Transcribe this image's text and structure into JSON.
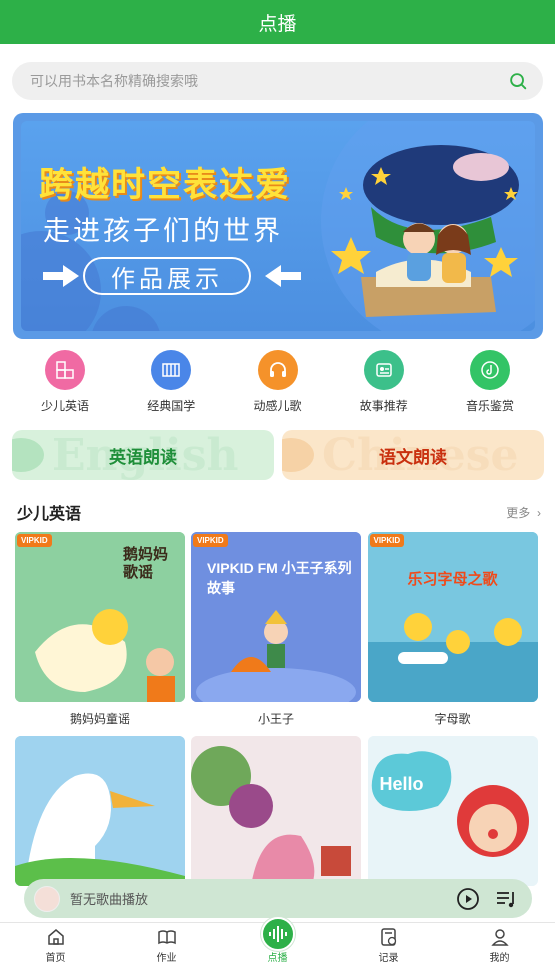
{
  "header": {
    "title": "点播"
  },
  "search": {
    "placeholder": "可以用书本名称精确搜索哦"
  },
  "banner": {
    "line1": "跨越时空表达爱",
    "line2": "走进孩子们的世界",
    "button": "作品展示"
  },
  "categories": [
    {
      "label": "少儿英语",
      "icon": "abc-blocks-icon",
      "color": "#f06aa3"
    },
    {
      "label": "经典国学",
      "icon": "book-scroll-icon",
      "color": "#4a86e8"
    },
    {
      "label": "动感儿歌",
      "icon": "headphones-icon",
      "color": "#f5922a"
    },
    {
      "label": "故事推荐",
      "icon": "story-icon",
      "color": "#3cc08a"
    },
    {
      "label": "音乐鉴赏",
      "icon": "music-disc-icon",
      "color": "#33c466"
    }
  ],
  "reading": [
    {
      "label": "英语朗读",
      "ghost": "English",
      "bg": "#d8f1dc",
      "color": "#1f8f3a"
    },
    {
      "label": "语文朗读",
      "ghost": "Chinese",
      "bg": "#fbe6c9",
      "color": "#c9300f"
    }
  ],
  "section": {
    "title": "少儿英语",
    "more": "更多"
  },
  "items": [
    {
      "title": "鹅妈妈童谣",
      "cover_text": "鹅妈妈歌谣",
      "badge": "VIPKID",
      "bg": "#8dd0a0"
    },
    {
      "title": "小王子",
      "cover_text": "VIPKID FM 小王子系列故事",
      "badge": "VIPKID",
      "bg": "#6f8fe0"
    },
    {
      "title": "字母歌",
      "cover_text": "乐习字母之歌",
      "badge": "VIPKID",
      "bg": "#79c7e0"
    },
    {
      "title": "",
      "cover_text": "",
      "badge": "",
      "bg": "#9fd3ef"
    },
    {
      "title": "",
      "cover_text": "",
      "badge": "",
      "bg": "#f2e7e9"
    },
    {
      "title": "",
      "cover_text": "Hello",
      "badge": "",
      "bg": "#e8f4f8"
    }
  ],
  "player": {
    "status": "暂无歌曲播放"
  },
  "tabs": [
    {
      "label": "首页",
      "icon": "home-icon"
    },
    {
      "label": "作业",
      "icon": "book-icon"
    },
    {
      "label": "点播",
      "icon": "audio-wave-icon"
    },
    {
      "label": "记录",
      "icon": "record-icon"
    },
    {
      "label": "我的",
      "icon": "user-icon"
    }
  ],
  "colors": {
    "brand": "#2db048",
    "player_bg": "#cfe6d3"
  }
}
